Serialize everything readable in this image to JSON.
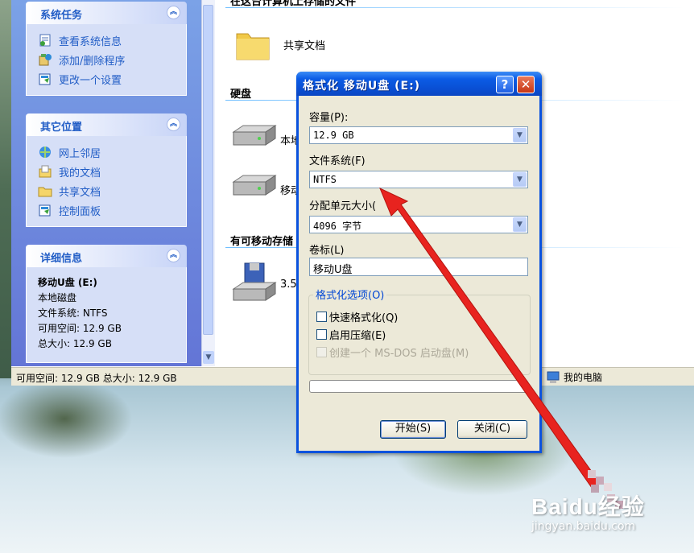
{
  "taskpane": {
    "system_tasks": {
      "title": "系统任务",
      "items": [
        "查看系统信息",
        "添加/删除程序",
        "更改一个设置"
      ]
    },
    "other_places": {
      "title": "其它位置",
      "items": [
        "网上邻居",
        "我的文档",
        "共享文档",
        "控制面板"
      ]
    },
    "details": {
      "title": "详细信息",
      "name": "移动U盘 (E:)",
      "type": "本地磁盘",
      "filesystem": "文件系统: NTFS",
      "free": "可用空间: 12.9 GB",
      "total": "总大小: 12.9 GB"
    }
  },
  "content": {
    "top_cut_text": "在这台计算机上存储的文件",
    "shared_docs": "共享文档",
    "hard_disk_section": "硬盘",
    "drive1_label": "本地",
    "drive2_label": "移动",
    "removable_section": "有可移动存储",
    "floppy_label": "3.5"
  },
  "statusbar": {
    "left": "可用空间: 12.9 GB 总大小: 12.9 GB",
    "right": "我的电脑"
  },
  "dialog": {
    "title": "格式化 移动U盘 (E:)",
    "help_glyph": "?",
    "close_glyph": "✕",
    "capacity_label": "容量(P):",
    "capacity_value": "12.9 GB",
    "filesystem_label": "文件系统(F)",
    "filesystem_value": "NTFS",
    "alloc_label": "分配单元大小(",
    "alloc_value": "4096 字节",
    "volume_label": "卷标(L)",
    "volume_value": "移动U盘",
    "options_legend": "格式化选项(O)",
    "quick_format": "快速格式化(Q)",
    "compression": "启用压缩(E)",
    "msdos": "创建一个 MS-DOS 启动盘(M)",
    "start_button": "开始(S)",
    "close_button": "关闭(C)"
  },
  "watermark": {
    "logo": "Baidu经验",
    "url": "jingyan.baidu.com"
  },
  "icons": {
    "chevron": "chevron-up-icon",
    "drop": "chevron-down-icon"
  },
  "colors": {
    "titlebar": "#0a52de",
    "taskpane": "#6f8ce0",
    "task_link": "#215dc6",
    "arrow": "#e8231f"
  }
}
